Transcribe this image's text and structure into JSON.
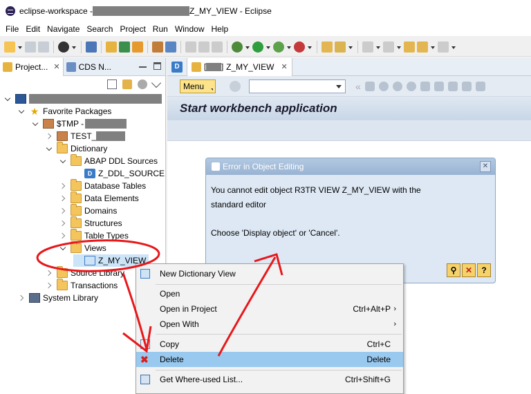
{
  "window": {
    "title_prefix": "eclipse-workspace - ",
    "title_suffix": "Z_MY_VIEW - Eclipse"
  },
  "menubar": {
    "items": [
      "File",
      "Edit",
      "Navigate",
      "Search",
      "Project",
      "Run",
      "Window",
      "Help"
    ]
  },
  "left_pane": {
    "tab_project": "Project...",
    "tab_cds": "CDS N...",
    "tree": {
      "favorite_packages": "Favorite Packages",
      "tmp_package": "$TMP -",
      "test_package": "TEST_",
      "dictionary": "Dictionary",
      "abap_ddl_sources": "ABAP DDL Sources",
      "z_ddl_source": "Z_DDL_SOURCE",
      "database_tables": "Database Tables",
      "data_elements": "Data Elements",
      "domains": "Domains",
      "structures": "Structures",
      "table_types": "Table Types",
      "views": "Views",
      "z_my_view": "Z_MY_VIEW",
      "source_library": "Source Library",
      "transactions": "Transactions",
      "system_library": "System Library"
    }
  },
  "editor": {
    "tab_label": "Z_MY_VIEW",
    "menu_button": "Menu",
    "title": "Start workbench application"
  },
  "dialog": {
    "title": "Error in Object Editing",
    "message_line1": "You cannot edit object R3TR VIEW Z_MY_VIEW with the",
    "message_line2": "standard editor",
    "message_line3": "Choose 'Display object' or 'Cancel'."
  },
  "context_menu": {
    "new_dictionary_view": "New Dictionary View",
    "open": "Open",
    "open_in_project": "Open in Project",
    "open_in_project_shortcut": "Ctrl+Alt+P",
    "open_with": "Open With",
    "copy": "Copy",
    "copy_shortcut": "Ctrl+C",
    "delete": "Delete",
    "delete_shortcut": "Delete",
    "where_used": "Get Where-used List...",
    "where_used_shortcut": "Ctrl+Shift+G",
    "submenu_arrow": "›"
  },
  "colors": {
    "annotation": "#e8171a",
    "highlight": "#99c9ef"
  }
}
